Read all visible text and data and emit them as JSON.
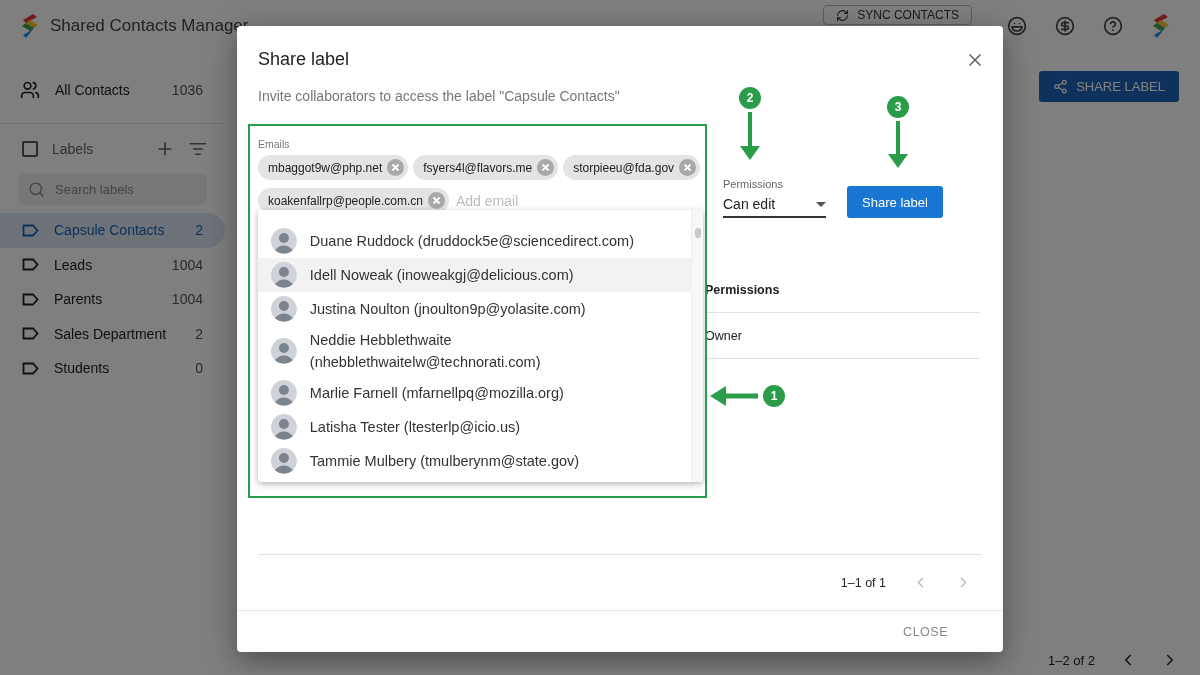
{
  "app": {
    "title": "Shared Contacts Manager",
    "sync_button": "SYNC CONTACTS",
    "share_button": "SHARE LABEL",
    "pagination": "1–2 of 2"
  },
  "sidebar": {
    "all_contacts": {
      "label": "All Contacts",
      "count": "1036"
    },
    "labels_heading": "Labels",
    "labels_checked": false,
    "search": {
      "placeholder": "Search labels"
    },
    "labels": [
      {
        "name": "Capsule Contacts",
        "count": "2",
        "selected": true
      },
      {
        "name": "Leads",
        "count": "1004",
        "selected": false
      },
      {
        "name": "Parents",
        "count": "1004",
        "selected": false
      },
      {
        "name": "Sales Department",
        "count": "2",
        "selected": false
      },
      {
        "name": "Students",
        "count": "0",
        "selected": false
      }
    ]
  },
  "dialog": {
    "title": "Share label",
    "subtitle": "Invite collaborators to access the label \"Capsule Contacts\"",
    "emails": {
      "label": "Emails",
      "chips": [
        "mbaggot9w@php.net",
        "fsyers4l@flavors.me",
        "storpieeu@fda.gov",
        "koakenfallrp@people.com.cn"
      ],
      "placeholder": "Add email"
    },
    "permissions": {
      "label": "Permissions",
      "value": "Can edit"
    },
    "submit": "Share label",
    "suggestions": [
      {
        "text": "Duane Ruddock (druddock5e@sciencedirect.com)",
        "selected": false
      },
      {
        "text": "Idell Noweak (inoweakgj@delicious.com)",
        "selected": true
      },
      {
        "text": "Justina Noulton (jnoulton9p@yolasite.com)",
        "selected": false
      },
      {
        "text": "Neddie Hebblethwaite (nhebblethwaitelw@technorati.com)",
        "selected": false
      },
      {
        "text": "Marlie Farnell (mfarnellpq@mozilla.org)",
        "selected": false
      },
      {
        "text": "Latisha Tester (ltesterlp@icio.us)",
        "selected": false
      },
      {
        "text": "Tammie Mulbery (tmulberynm@state.gov)",
        "selected": false
      }
    ],
    "table": {
      "columns": [
        "Permissions"
      ],
      "rows": [
        [
          "Owner"
        ]
      ]
    },
    "pagination": "1–1 of 1",
    "close": "CLOSE"
  },
  "annotations": [
    {
      "number": "1"
    },
    {
      "number": "2"
    },
    {
      "number": "3"
    }
  ]
}
